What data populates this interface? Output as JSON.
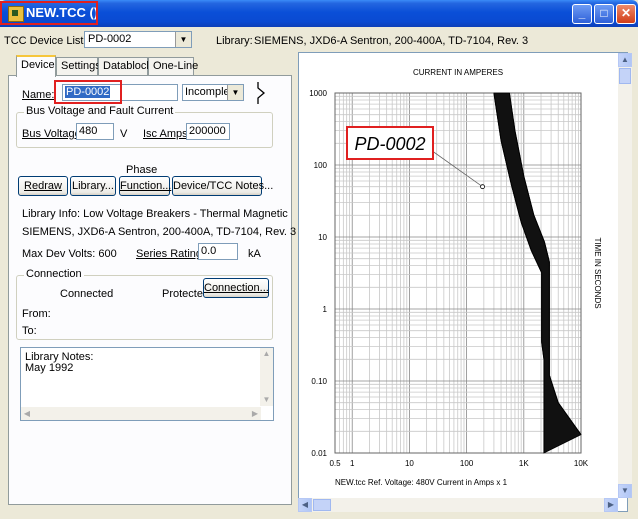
{
  "window": {
    "title": "NEW.TCC ()"
  },
  "toolbar": {
    "device_list_label": "TCC Device List:",
    "device_list_value": "PD-0002",
    "library_label": "Library:",
    "library_value": "SIEMENS, JXD6-A Sentron, 200-400A, TD-7104, Rev. 3"
  },
  "tabs": [
    {
      "label": "Device",
      "active": true
    },
    {
      "label": "Settings"
    },
    {
      "label": "Datablock"
    },
    {
      "label": "One-Line"
    }
  ],
  "device": {
    "name_label": "Name:",
    "name_value": "PD-0002",
    "status_value": "Incomplete",
    "bus_group_label": "Bus Voltage and Fault Current",
    "bus_voltage_label": "Bus Voltage:",
    "bus_voltage_value": "480",
    "bus_voltage_unit": "V",
    "isc_label": "Isc Amps:",
    "isc_value": "200000",
    "phase_label": "Phase",
    "buttons": {
      "redraw": "Redraw",
      "library": "Library...",
      "function": "Function...",
      "notes": "Device/TCC Notes..."
    },
    "library_info": "Library Info:  Low Voltage Breakers - Thermal Magnetic",
    "library_line2": "SIEMENS, JXD6-A Sentron, 200-400A, TD-7104, Rev. 3",
    "max_dev_volts": "Max Dev Volts:  600",
    "series_rating_label": "Series Rating:",
    "series_rating_value": "0.0",
    "series_rating_unit": "kA",
    "connection_group": "Connection",
    "connected_label": "Connected",
    "protected_label": "Protected",
    "connection_button": "Connection...",
    "from_label": "From:",
    "to_label": "To:",
    "notes_text": "Library Notes:\nMay 1992"
  },
  "chart_data": {
    "type": "line",
    "title": "CURRENT IN AMPERES",
    "ylabel": "TIME IN SECONDS",
    "x_ticks": [
      "0.5",
      "1",
      "10",
      "100",
      "1K",
      "10K"
    ],
    "y_ticks": [
      "1000",
      "100",
      "10",
      "1",
      "0.10",
      "0.01"
    ],
    "xlim": [
      0.5,
      10000
    ],
    "ylim": [
      0.01,
      1000
    ],
    "x_scale": "log",
    "y_scale": "log",
    "annotation": "PD-0002",
    "footer": "NEW.tcc   Ref. Voltage: 480V   Current in Amps x 1",
    "series": [
      {
        "x": [
          300,
          400,
          600,
          900,
          1350,
          2050,
          2050,
          2250,
          2250
        ],
        "y": [
          1000,
          220,
          55,
          16,
          6.5,
          3.2,
          0.35,
          0.2,
          0.01
        ]
      },
      {
        "x": [
          560,
          700,
          1000,
          1500,
          2300,
          2800,
          2800,
          4000,
          10000
        ],
        "y": [
          1000,
          300,
          70,
          20,
          8.5,
          4.5,
          0.12,
          0.05,
          0.018
        ]
      }
    ]
  }
}
